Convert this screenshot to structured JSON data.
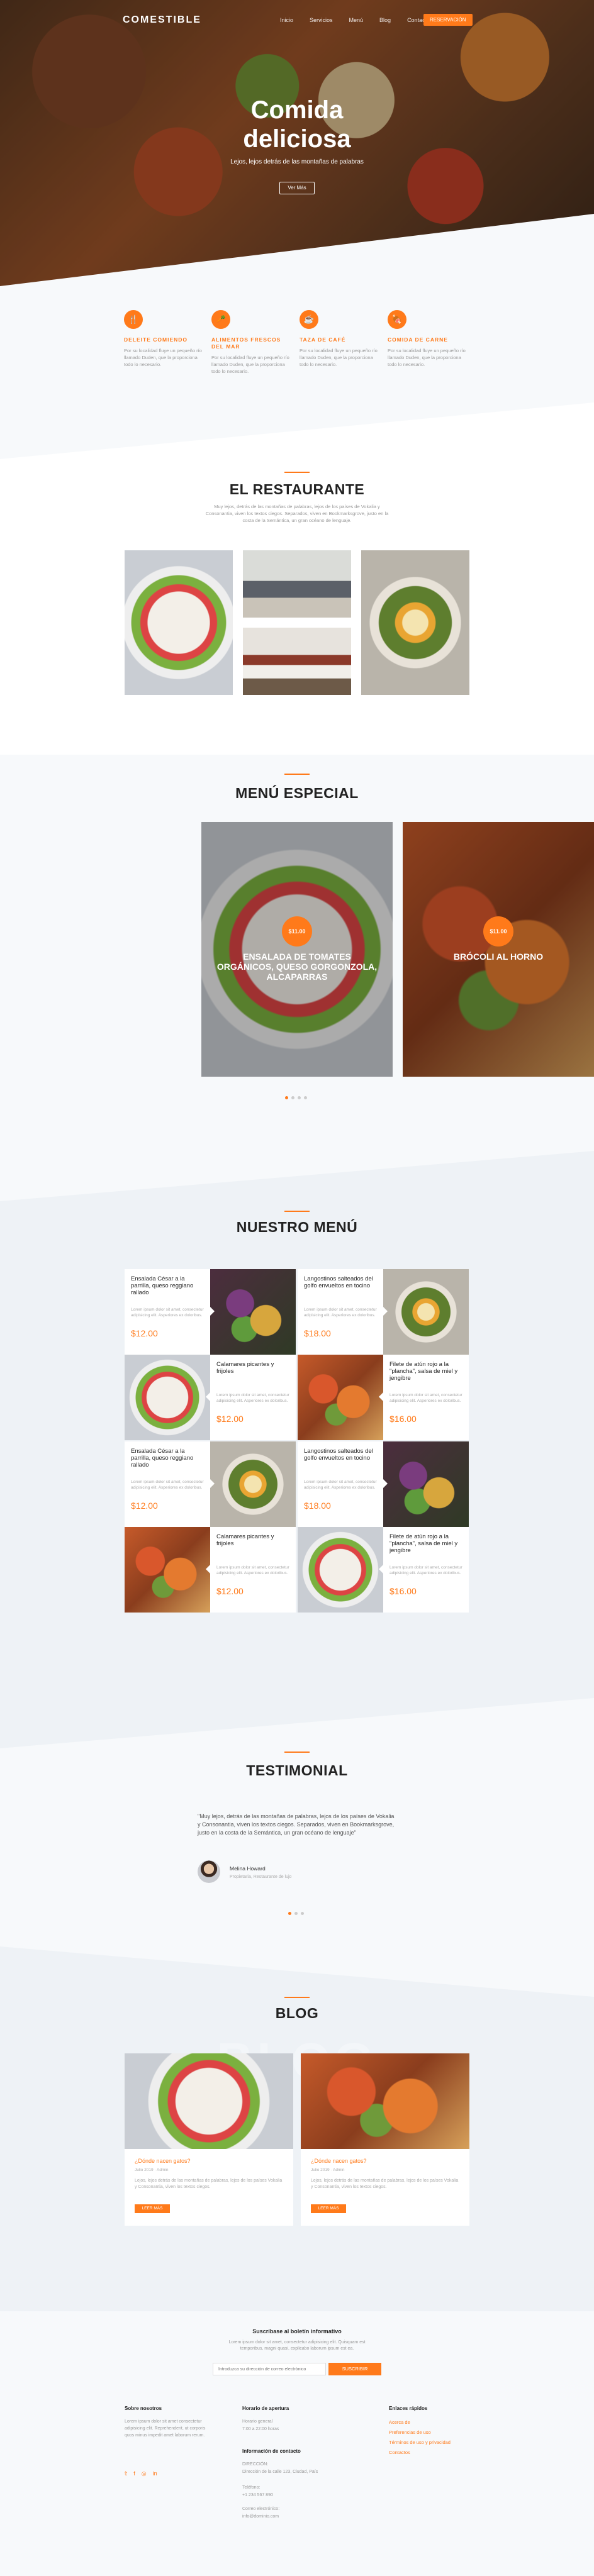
{
  "nav": {
    "logo": "COMESTIBLE",
    "items": [
      "Inicio",
      "Servicios",
      "Menú",
      "Blog",
      "Contacto"
    ],
    "reserve_button": "RESERVACIÓN"
  },
  "hero": {
    "title_line1": "Comida",
    "title_line2": "deliciosa",
    "subtitle": "Lejos, lejos detrás de las montañas de palabras",
    "button": "Ver Más"
  },
  "features": [
    {
      "icon": "utensils-icon",
      "glyph": "🍴",
      "title": "DELEITE COMIENDO",
      "text": "Por su localidad fluye un pequeño río llamado Duden, que la proporciona todo lo necesario."
    },
    {
      "icon": "carrot-icon",
      "glyph": "🥕",
      "title": "ALIMENTOS FRESCOS DEL MAR",
      "text": "Por su localidad fluye un pequeño río llamado Duden, que la proporciona todo lo necesario."
    },
    {
      "icon": "coffee-icon",
      "glyph": "☕",
      "title": "TAZA DE CAFÉ",
      "text": "Por su localidad fluye un pequeño río llamado Duden, que la proporciona todo lo necesario."
    },
    {
      "icon": "meat-icon",
      "glyph": "🍖",
      "title": "COMIDA DE CARNE",
      "text": "Por su localidad fluye un pequeño río llamado Duden, que la proporciona todo lo necesario."
    }
  ],
  "restaurant": {
    "title": "EL RESTAURANTE",
    "text": "Muy lejos, detrás de las montañas de palabras, lejos de los países de Vokalia y Consonantia, viven los textos ciegos. Separados, viven en Bookmarksgrove, justo en la costa de la Semántica, un gran océano de lenguaje."
  },
  "special": {
    "title": "MENÚ ESPECIAL",
    "items": [
      {
        "price": "$11.00",
        "name": "ENSALADA DE TOMATES ORGÁNICOS, QUESO GORGONZOLA, ALCAPARRAS"
      },
      {
        "price": "$11.00",
        "name": "BRÓCOLI AL HORNO"
      }
    ]
  },
  "menu": {
    "title": "NUESTRO MENÚ",
    "desc": "Lorem ipsum dolor sit amet, consectetur adipisicing elit. Asperiores ex doloribus.",
    "items": [
      {
        "name": "Ensalada César a la parrilla, queso reggiano rallado",
        "price": "$12.00"
      },
      {
        "name": "Langostinos salteados del golfo envueltos en tocino",
        "price": "$18.00"
      },
      {
        "name": "Calamares picantes y frijoles",
        "price": "$12.00"
      },
      {
        "name": "Filete de atún rojo a la \"plancha\", salsa de miel y jengibre",
        "price": "$16.00"
      },
      {
        "name": "Ensalada César a la parrilla, queso reggiano rallado",
        "price": "$12.00"
      },
      {
        "name": "Langostinos salteados del golfo envueltos en tocino",
        "price": "$18.00"
      },
      {
        "name": "Calamares picantes y frijoles",
        "price": "$12.00"
      },
      {
        "name": "Filete de atún rojo a la \"plancha\", salsa de miel y jengibre",
        "price": "$16.00"
      }
    ]
  },
  "testimonial": {
    "title": "TESTIMONIAL",
    "quote": "\"Muy lejos, detrás de las montañas de palabras, lejos de los países de Vokalia y Consonantia, viven los textos ciegos. Separados, viven en Bookmarksgrove, justo en la costa de la Semántica, un gran océano de lenguaje\"",
    "name": "Melina Howard",
    "role": "Propietaria, Restaurante de lujo"
  },
  "blog": {
    "title": "BLOG",
    "posts": [
      {
        "title": "¿Dónde nacen gatos?",
        "meta": "Julio 2019 · Admin",
        "text": "Lejos, lejos detrás de las montañas de palabras, lejos de los países Vokalia y Consonantia, viven los textos ciegos.",
        "button": "LEER MÁS"
      },
      {
        "title": "¿Dónde nacen gatos?",
        "meta": "Julio 2019 · Admin",
        "text": "Lejos, lejos detrás de las montañas de palabras, lejos de los países Vokalia y Consonantia, viven los textos ciegos.",
        "button": "LEER MÁS"
      }
    ]
  },
  "newsletter": {
    "title": "Suscríbase al boletín informativo",
    "text": "Lorem ipsum dolor sit amet, consectetur adipisicing elit. Quisquam est temporibus, magni quasi, explicabo laborum ipsum est ea.",
    "placeholder": "Introduzca su dirección de correo electrónico",
    "button": "SUSCRIBIR"
  },
  "footer": {
    "about_title": "Sobre nosotros",
    "about_text": "Lorem ipsum dolor sit amet consectetur adipisicing elit. Reprehenderit, ut corporis quos minus impedit amet laborum rerum.",
    "hours_title": "Horario de apertura",
    "hours_text": "Horario general",
    "hours_value": "7:00 a 22:00 horas",
    "contact_title": "Información de contacto",
    "address_label": "DIRECCIÓN:",
    "address": "Dirección de la calle 123, Ciudad, País",
    "phone_label": "Teléfono:",
    "phone": "+1 234 567 890",
    "email_label": "Correo electrónico:",
    "email": "info@dominio.com",
    "links_title": "Enlaces rápidos",
    "links": [
      "Acerca de",
      "Preferencias de uso",
      "Términos de uso y privacidad",
      "Contactos"
    ],
    "social": [
      "twitter-icon",
      "facebook-icon",
      "instagram-icon",
      "linkedin-icon"
    ]
  }
}
